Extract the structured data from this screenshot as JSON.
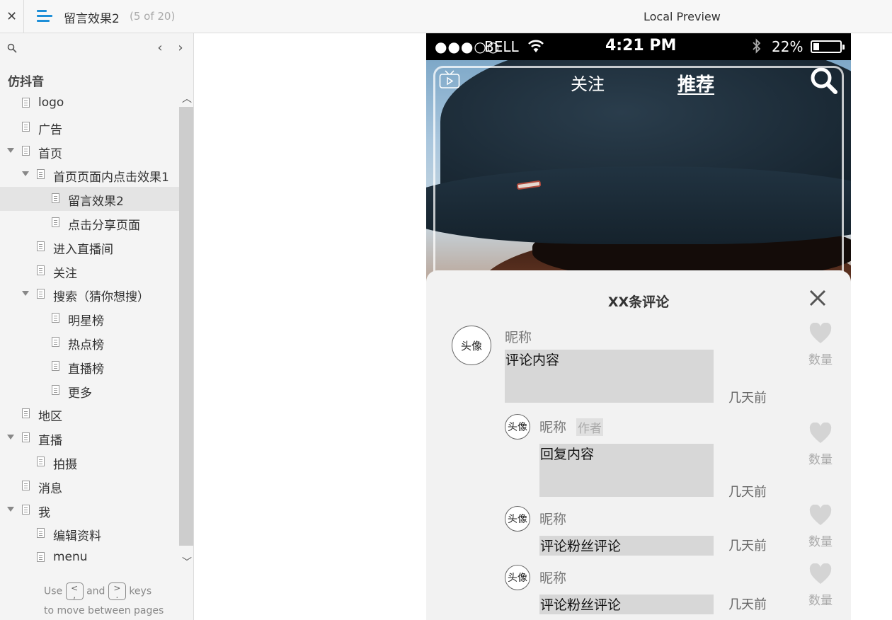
{
  "topbar": {
    "close_glyph": "✕",
    "page_title": "留言效果2",
    "page_count": "(5 of 20)",
    "preview_label": "Local Preview"
  },
  "sidebar": {
    "prev_glyph": "‹",
    "next_glyph": "›",
    "project_name": "仿抖音",
    "items": [
      {
        "label": "logo",
        "level": 0,
        "expanded": null,
        "selected": false
      },
      {
        "label": "广告",
        "level": 0,
        "expanded": null,
        "selected": false
      },
      {
        "label": "首页",
        "level": 0,
        "expanded": true,
        "selected": false
      },
      {
        "label": "首页页面内点击效果1",
        "level": 1,
        "expanded": true,
        "selected": false
      },
      {
        "label": "留言效果2",
        "level": 2,
        "expanded": null,
        "selected": true
      },
      {
        "label": "点击分享页面",
        "level": 2,
        "expanded": null,
        "selected": false
      },
      {
        "label": "进入直播间",
        "level": 1,
        "expanded": null,
        "selected": false
      },
      {
        "label": "关注",
        "level": 1,
        "expanded": null,
        "selected": false
      },
      {
        "label": "搜索（猜你想搜）",
        "level": 1,
        "expanded": true,
        "selected": false
      },
      {
        "label": "明星榜",
        "level": 2,
        "expanded": null,
        "selected": false
      },
      {
        "label": "热点榜",
        "level": 2,
        "expanded": null,
        "selected": false
      },
      {
        "label": "直播榜",
        "level": 2,
        "expanded": null,
        "selected": false
      },
      {
        "label": "更多",
        "level": 2,
        "expanded": null,
        "selected": false
      },
      {
        "label": "地区",
        "level": 0,
        "expanded": null,
        "selected": false
      },
      {
        "label": "直播",
        "level": 0,
        "expanded": true,
        "selected": false
      },
      {
        "label": "拍摄",
        "level": 1,
        "expanded": null,
        "selected": false
      },
      {
        "label": "消息",
        "level": 0,
        "expanded": null,
        "selected": false
      },
      {
        "label": "我",
        "level": 0,
        "expanded": true,
        "selected": false
      },
      {
        "label": "编辑资料",
        "level": 1,
        "expanded": null,
        "selected": false
      },
      {
        "label": "menu",
        "level": 1,
        "expanded": null,
        "selected": false
      }
    ],
    "hint": {
      "use": "Use",
      "key_prev": "<\n,",
      "and": "and",
      "key_next": ">\n.",
      "keys": "keys",
      "line2": "to move between pages"
    }
  },
  "phone": {
    "status": {
      "signal": "●●●○○",
      "carrier": "BELL",
      "time": "4:21 PM",
      "battery_text": "22%",
      "battery_level": 0.22
    },
    "nav": {
      "follow": "关注",
      "recommend": "推荐"
    },
    "comments_panel": {
      "title": "XX条评论",
      "comments": [
        {
          "avatar": "头像",
          "nickname": "昵称",
          "author_tag": "",
          "content": "评论内容",
          "time": "几天前",
          "likes": "数量"
        },
        {
          "avatar": "头像",
          "nickname": "昵称",
          "author_tag": "作者",
          "content": "回复内容",
          "time": "几天前",
          "likes": "数量"
        },
        {
          "avatar": "头像",
          "nickname": "昵称",
          "author_tag": "",
          "content": "评论粉丝评论",
          "time": "几天前",
          "likes": "数量"
        },
        {
          "avatar": "头像",
          "nickname": "昵称",
          "author_tag": "",
          "content": "评论粉丝评论",
          "time": "几天前",
          "likes": "数量"
        }
      ]
    }
  }
}
